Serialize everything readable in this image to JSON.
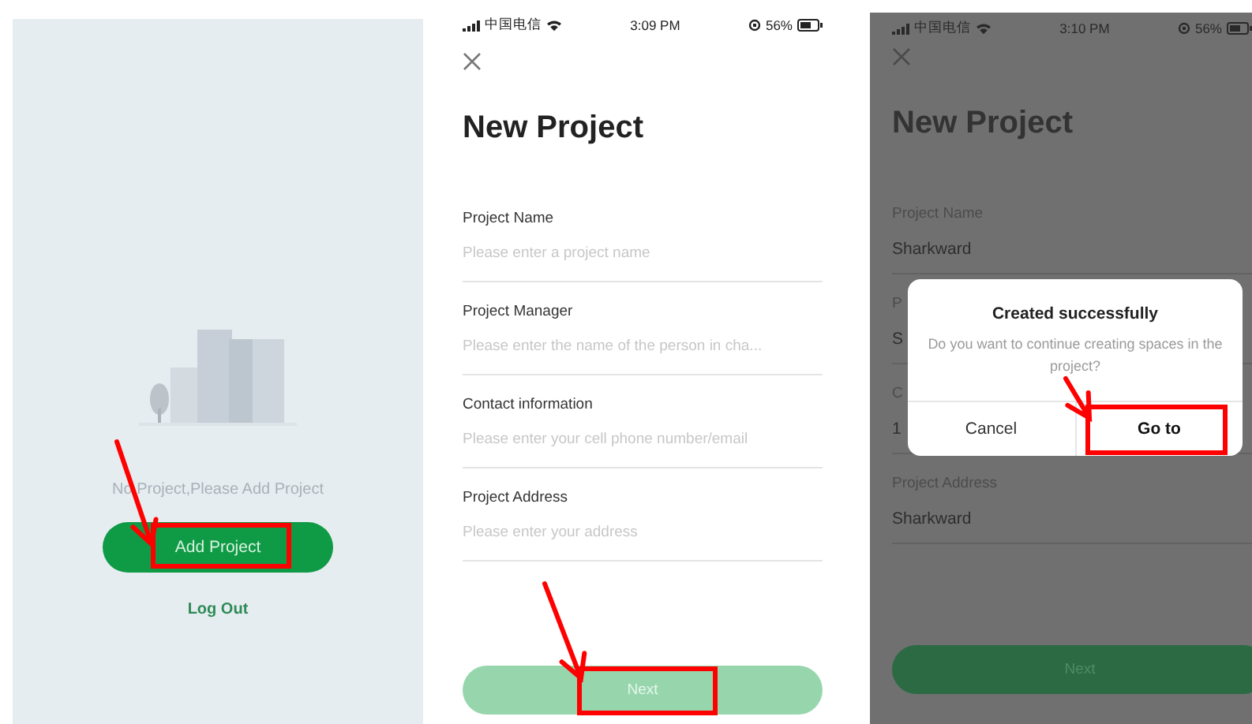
{
  "screens": [
    {
      "kind": "empty",
      "message": "No Project,Please Add Project",
      "primary_button": "Add Project",
      "link": "Log Out"
    },
    {
      "kind": "form",
      "status_bar": {
        "carrier": "中国电信",
        "time": "3:09 PM",
        "battery": "56%"
      },
      "title": "New Project",
      "fields": [
        {
          "label": "Project Name",
          "placeholder": "Please enter a project name"
        },
        {
          "label": "Project Manager",
          "placeholder": "Please enter the name of the person in cha..."
        },
        {
          "label": "Contact information",
          "placeholder": "Please enter your cell phone number/email"
        },
        {
          "label": "Project Address",
          "placeholder": "Please enter your address"
        }
      ],
      "next_button": {
        "label": "Next",
        "disabled": true
      }
    },
    {
      "kind": "form_dialog",
      "status_bar": {
        "carrier": "中国电信",
        "time": "3:10 PM",
        "battery": "56%"
      },
      "title": "New Project",
      "fields": [
        {
          "label": "Project Name",
          "value": "Sharkward"
        },
        {
          "label": "P",
          "value": "S"
        },
        {
          "label": "C",
          "value": "1"
        },
        {
          "label": "Project Address",
          "value": "Sharkward"
        }
      ],
      "next_button": {
        "label": "Next",
        "disabled": false
      },
      "dialog": {
        "title": "Created successfully",
        "message": "Do you want to continue creating spaces in the project?",
        "buttons": [
          "Cancel",
          "Go to"
        ]
      }
    }
  ]
}
